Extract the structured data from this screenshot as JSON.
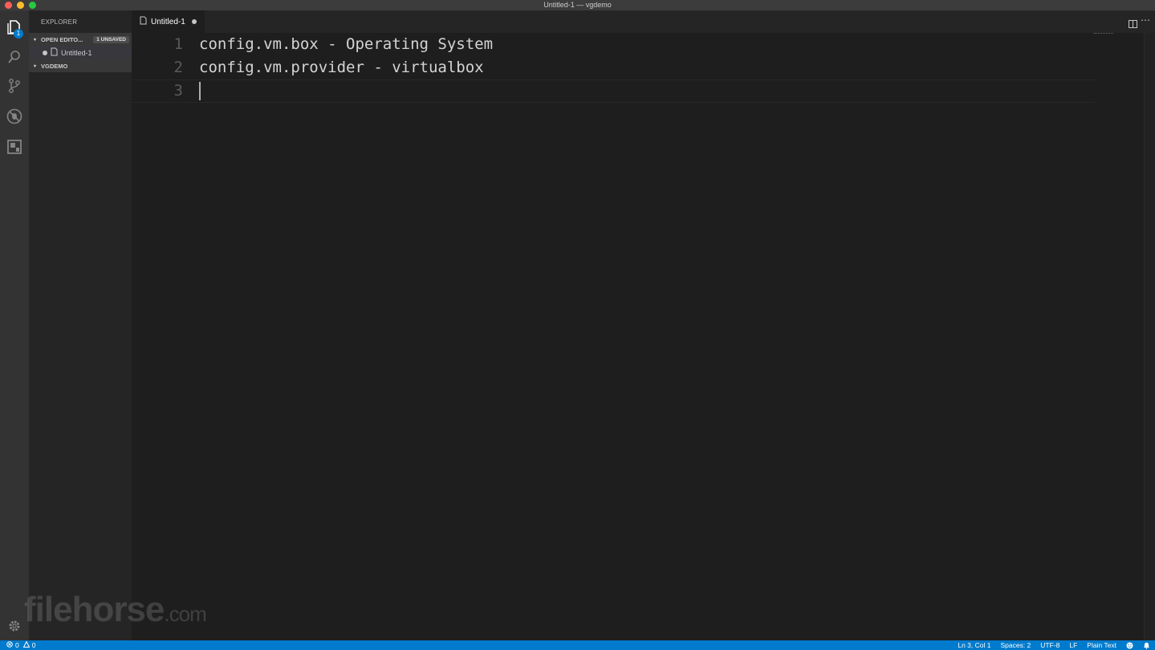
{
  "window": {
    "title": "Untitled-1 — vgdemo"
  },
  "activity_bar": {
    "explorer_badge": "1",
    "items": [
      "files-icon",
      "search-icon",
      "source-control-icon",
      "debug-icon",
      "extensions-icon"
    ],
    "settings": "gear-icon"
  },
  "sidebar": {
    "title": "EXPLORER",
    "open_editors": {
      "label": "OPEN EDITO...",
      "badge": "1 UNSAVED",
      "files": [
        {
          "name": "Untitled-1"
        }
      ]
    },
    "folder": {
      "label": "VGDEMO"
    }
  },
  "tabs": [
    {
      "label": "Untitled-1",
      "dirty": true
    }
  ],
  "editor": {
    "lines": [
      {
        "number": "1",
        "text": "config.vm.box - Operating System"
      },
      {
        "number": "2",
        "text": "config.vm.provider - virtualbox"
      },
      {
        "number": "3",
        "text": ""
      }
    ]
  },
  "watermark": {
    "main": "filehorse",
    "suffix": ".com"
  },
  "status_bar": {
    "errors": "0",
    "warnings": "0",
    "position": "Ln 3, Col 1",
    "indent": "Spaces: 2",
    "encoding": "UTF-8",
    "eol": "LF",
    "language": "Plain Text"
  },
  "colors": {
    "accent": "#007acc",
    "editor_bg": "#1e1e1e",
    "sidebar_bg": "#252526",
    "activity_bg": "#333333"
  }
}
